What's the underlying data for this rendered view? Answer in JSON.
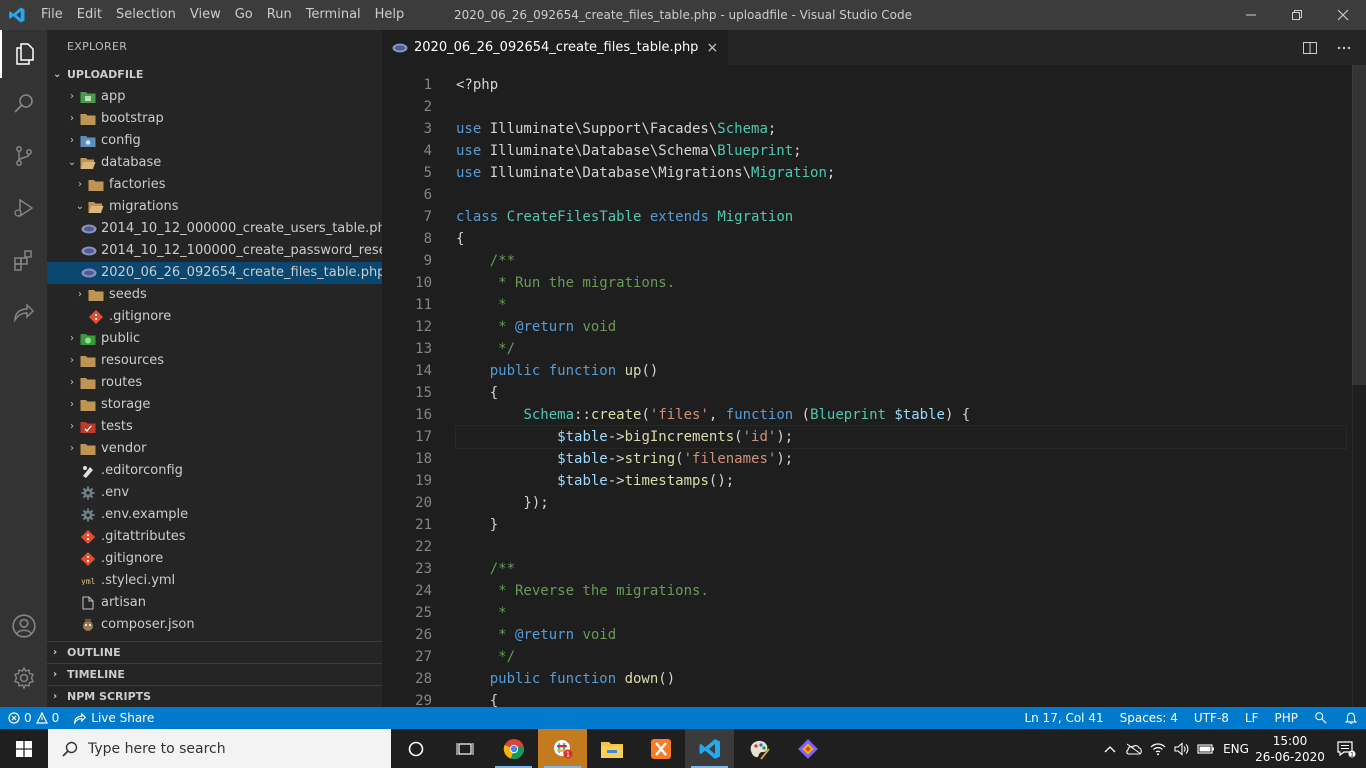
{
  "titlebar": {
    "menu": [
      "File",
      "Edit",
      "Selection",
      "View",
      "Go",
      "Run",
      "Terminal",
      "Help"
    ],
    "title": "2020_06_26_092654_create_files_table.php - uploadfile - Visual Studio Code"
  },
  "sidebar": {
    "title": "EXPLORER",
    "root": "UPLOADFILE",
    "tree": [
      {
        "label": "app",
        "depth": 0,
        "chev": "›",
        "icon": "folder-app-icon"
      },
      {
        "label": "bootstrap",
        "depth": 0,
        "chev": "›",
        "icon": "folder-icon"
      },
      {
        "label": "config",
        "depth": 0,
        "chev": "›",
        "icon": "folder-config-icon"
      },
      {
        "label": "database",
        "depth": 0,
        "chev": "⌄",
        "icon": "folder-open-icon"
      },
      {
        "label": "factories",
        "depth": 1,
        "chev": "›",
        "icon": "folder-icon"
      },
      {
        "label": "migrations",
        "depth": 1,
        "chev": "⌄",
        "icon": "folder-open-icon"
      },
      {
        "label": "2014_10_12_000000_create_users_table.php",
        "depth": 2,
        "chev": "",
        "icon": "php-file-icon"
      },
      {
        "label": "2014_10_12_100000_create_password_reset...",
        "depth": 2,
        "chev": "",
        "icon": "php-file-icon"
      },
      {
        "label": "2020_06_26_092654_create_files_table.php",
        "depth": 2,
        "chev": "",
        "icon": "php-file-icon",
        "selected": true
      },
      {
        "label": "seeds",
        "depth": 1,
        "chev": "›",
        "icon": "folder-icon"
      },
      {
        "label": ".gitignore",
        "depth": 1,
        "chev": "",
        "icon": "git-file-icon"
      },
      {
        "label": "public",
        "depth": 0,
        "chev": "›",
        "icon": "folder-public-icon"
      },
      {
        "label": "resources",
        "depth": 0,
        "chev": "›",
        "icon": "folder-icon"
      },
      {
        "label": "routes",
        "depth": 0,
        "chev": "›",
        "icon": "folder-icon"
      },
      {
        "label": "storage",
        "depth": 0,
        "chev": "›",
        "icon": "folder-icon"
      },
      {
        "label": "tests",
        "depth": 0,
        "chev": "›",
        "icon": "folder-tests-icon"
      },
      {
        "label": "vendor",
        "depth": 0,
        "chev": "›",
        "icon": "folder-icon"
      },
      {
        "label": ".editorconfig",
        "depth": 0,
        "chev": "",
        "icon": "editorconfig-icon"
      },
      {
        "label": ".env",
        "depth": 0,
        "chev": "",
        "icon": "gear-file-icon"
      },
      {
        "label": ".env.example",
        "depth": 0,
        "chev": "",
        "icon": "gear-file-icon"
      },
      {
        "label": ".gitattributes",
        "depth": 0,
        "chev": "",
        "icon": "git-file-icon"
      },
      {
        "label": ".gitignore",
        "depth": 0,
        "chev": "",
        "icon": "git-file-icon"
      },
      {
        "label": ".styleci.yml",
        "depth": 0,
        "chev": "",
        "icon": "yml-file-icon"
      },
      {
        "label": "artisan",
        "depth": 0,
        "chev": "",
        "icon": "file-icon"
      },
      {
        "label": "composer.json",
        "depth": 0,
        "chev": "",
        "icon": "composer-file-icon"
      }
    ],
    "sections": [
      "OUTLINE",
      "TIMELINE",
      "NPM SCRIPTS"
    ]
  },
  "editor": {
    "tab_label": "2020_06_26_092654_create_files_table.php",
    "tab_close": "×",
    "current_line": 17,
    "lines": [
      [
        [
          "plain",
          "<?php"
        ]
      ],
      [],
      [
        [
          "kw",
          "use "
        ],
        [
          "plain",
          "Illuminate\\Support\\Facades\\"
        ],
        [
          "cls",
          "Schema"
        ],
        [
          "plain",
          ";"
        ]
      ],
      [
        [
          "kw",
          "use "
        ],
        [
          "plain",
          "Illuminate\\Database\\Schema\\"
        ],
        [
          "cls",
          "Blueprint"
        ],
        [
          "plain",
          ";"
        ]
      ],
      [
        [
          "kw",
          "use "
        ],
        [
          "plain",
          "Illuminate\\Database\\Migrations\\"
        ],
        [
          "cls",
          "Migration"
        ],
        [
          "plain",
          ";"
        ]
      ],
      [],
      [
        [
          "kw",
          "class "
        ],
        [
          "cls",
          "CreateFilesTable "
        ],
        [
          "kw",
          "extends "
        ],
        [
          "cls",
          "Migration"
        ]
      ],
      [
        [
          "plain",
          "{"
        ]
      ],
      [
        [
          "plain",
          "    "
        ],
        [
          "cmt",
          "/**"
        ]
      ],
      [
        [
          "cmt",
          "     * Run the migrations."
        ]
      ],
      [
        [
          "cmt",
          "     *"
        ]
      ],
      [
        [
          "cmt",
          "     * "
        ],
        [
          "kw",
          "@return "
        ],
        [
          "cmt",
          "void"
        ]
      ],
      [
        [
          "cmt",
          "     */"
        ]
      ],
      [
        [
          "plain",
          "    "
        ],
        [
          "kw",
          "public function "
        ],
        [
          "fn",
          "up"
        ],
        [
          "plain",
          "()"
        ]
      ],
      [
        [
          "plain",
          "    {"
        ]
      ],
      [
        [
          "plain",
          "        "
        ],
        [
          "cls",
          "Schema"
        ],
        [
          "plain",
          "::"
        ],
        [
          "fn",
          "create"
        ],
        [
          "plain",
          "("
        ],
        [
          "str",
          "'files'"
        ],
        [
          "plain",
          ", "
        ],
        [
          "kw",
          "function "
        ],
        [
          "plain",
          "("
        ],
        [
          "cls",
          "Blueprint "
        ],
        [
          "var",
          "$table"
        ],
        [
          "plain",
          ") {"
        ]
      ],
      [
        [
          "plain",
          "            "
        ],
        [
          "var",
          "$table"
        ],
        [
          "plain",
          "->"
        ],
        [
          "fn",
          "bigIncrements"
        ],
        [
          "plain",
          "("
        ],
        [
          "str",
          "'id'"
        ],
        [
          "plain",
          ");"
        ]
      ],
      [
        [
          "plain",
          "            "
        ],
        [
          "var",
          "$table"
        ],
        [
          "plain",
          "->"
        ],
        [
          "fn",
          "string"
        ],
        [
          "plain",
          "("
        ],
        [
          "str",
          "'filenames'"
        ],
        [
          "plain",
          ");"
        ]
      ],
      [
        [
          "plain",
          "            "
        ],
        [
          "var",
          "$table"
        ],
        [
          "plain",
          "->"
        ],
        [
          "fn",
          "timestamps"
        ],
        [
          "plain",
          "();"
        ]
      ],
      [
        [
          "plain",
          "        });"
        ]
      ],
      [
        [
          "plain",
          "    }"
        ]
      ],
      [],
      [
        [
          "plain",
          "    "
        ],
        [
          "cmt",
          "/**"
        ]
      ],
      [
        [
          "cmt",
          "     * Reverse the migrations."
        ]
      ],
      [
        [
          "cmt",
          "     *"
        ]
      ],
      [
        [
          "cmt",
          "     * "
        ],
        [
          "kw",
          "@return "
        ],
        [
          "cmt",
          "void"
        ]
      ],
      [
        [
          "cmt",
          "     */"
        ]
      ],
      [
        [
          "plain",
          "    "
        ],
        [
          "kw",
          "public function "
        ],
        [
          "fn",
          "down"
        ],
        [
          "plain",
          "()"
        ]
      ],
      [
        [
          "plain",
          "    {"
        ]
      ]
    ]
  },
  "statusbar": {
    "errors": "0",
    "warnings": "0",
    "live_share": "Live Share",
    "position": "Ln 17, Col 41",
    "spaces": "Spaces: 4",
    "encoding": "UTF-8",
    "eol": "LF",
    "language": "PHP"
  },
  "taskbar": {
    "search_placeholder": "Type here to search",
    "lang": "ENG",
    "time": "15:00",
    "date": "26-06-2020",
    "notification_count": "1"
  },
  "colors": {
    "accent": "#007acc",
    "selection": "#094771",
    "keyword": "#569cd6",
    "class": "#4ec9b0",
    "function": "#dcdcaa",
    "string": "#ce9178",
    "variable": "#9cdcfe",
    "comment": "#6a9955"
  }
}
